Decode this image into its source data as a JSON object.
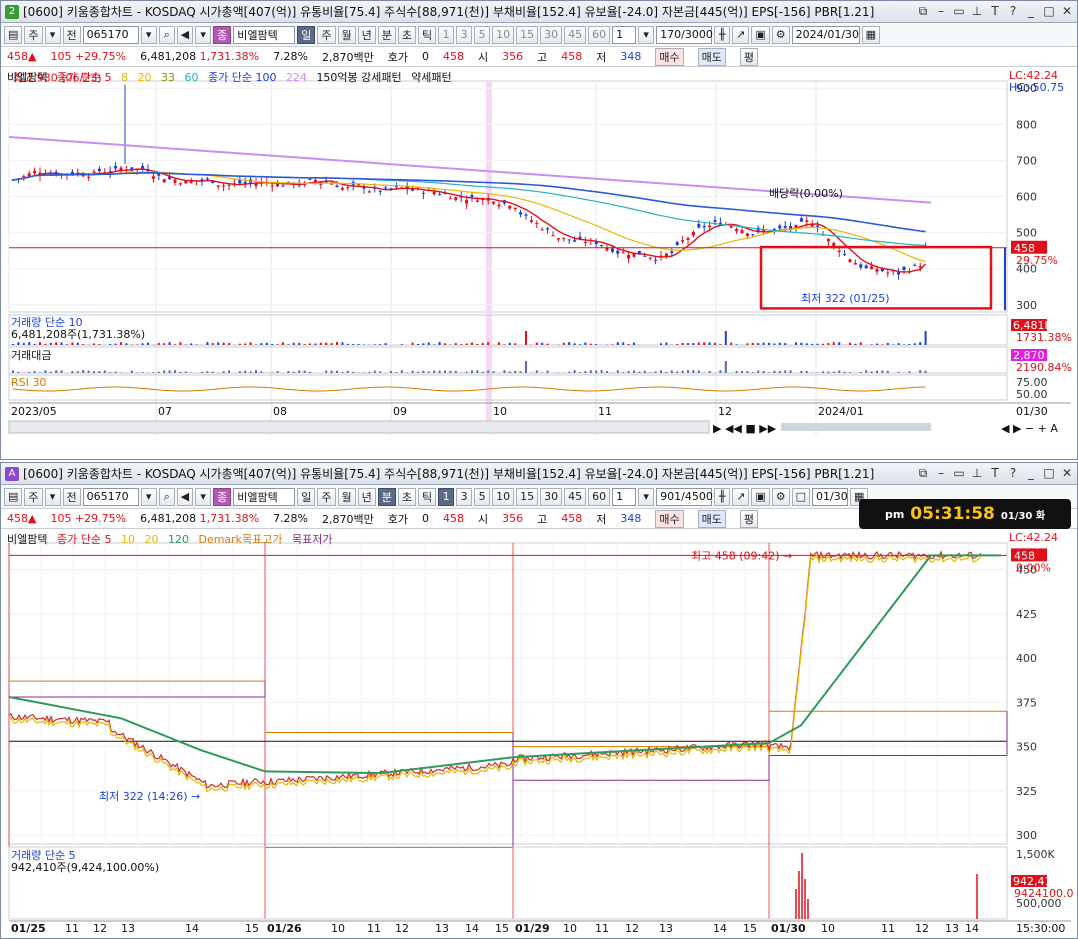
{
  "top": {
    "badge": "2",
    "title": "[0600] 키움종합차트 - KOSDAQ 시가총액[407(억)] 유통비율[75.4] 주식수[88,971(천)] 부채비율[152.4] 유보율[-24.0] 자본금[445(억)] EPS[-156] PBR[1.21]",
    "code": "065170",
    "type_label": "주",
    "prev_label": "전",
    "indicator_label": "비엘팜텍",
    "periods": [
      "일",
      "주",
      "월",
      "년",
      "분",
      "초",
      "틱"
    ],
    "selected_period": "일",
    "minutes": [
      "1",
      "3",
      "5",
      "10",
      "15",
      "30",
      "45",
      "60"
    ],
    "count_value": "1",
    "range_value": "170/3000",
    "date_value": "2024/01/30",
    "quote": {
      "price": "458",
      "change": "105",
      "rate": "+29.75%",
      "volume": "6,481,208",
      "vol_rate": "1,731.38%",
      "turnover": "7.28%",
      "amount": "2,870백만",
      "hoga_label": "호가",
      "hoga": "0",
      "cur": "458",
      "open_label": "시",
      "open": "356",
      "high_label": "고",
      "high": "458",
      "low_label": "저",
      "low": "348",
      "buy": "매수",
      "sell": "매도",
      "flat": "평"
    },
    "legend": [
      "비엘팜텍",
      "종가 단순 5",
      "8",
      "20",
      "33",
      "60",
      "종가 단순 100",
      "224",
      "150억봉 강세패턴",
      "약세패턴"
    ],
    "high_annot": "최고 930 (06/23)",
    "low_annot": "최저 322 (01/25)",
    "div_annot": "배당락(0.00%)",
    "lc": "LC:42.24",
    "hc": "HC:-50.75",
    "price_ticks": [
      "900",
      "800",
      "700",
      "600",
      "500",
      "400",
      "300"
    ],
    "last_price": "458",
    "last_rate": "29.75%",
    "vol_legend": [
      "거래량",
      "단순 10"
    ],
    "vol_value": "6,481,208주(1,731.38%)",
    "vol_right": "6,481K",
    "vol_right2": "1731.38%",
    "amt_legend": "거래대금",
    "amt_right": "2,870",
    "amt_right2": "2190.84%",
    "rsi_legend": "RSI 30",
    "rsi_ticks": [
      "75.00",
      "50.00"
    ],
    "x_labels": [
      "2023/05",
      "07",
      "08",
      "09",
      "10",
      "11",
      "12",
      "2024/01"
    ],
    "x_right": "01/30"
  },
  "bottom": {
    "badge": "A",
    "title": "[0600] 키움종합차트 - KOSDAQ 시가총액[407(억)] 유통비율[75.4] 주식수[88,971(천)] 부채비율[152.4] 유보율[-24.0] 자본금[445(억)] EPS[-156] PBR[1.21]",
    "code": "065170",
    "type_label": "주",
    "prev_label": "전",
    "indicator_label": "비엘팜텍",
    "periods": [
      "일",
      "주",
      "월",
      "년",
      "분",
      "초",
      "틱"
    ],
    "selected_period": "분",
    "minutes": [
      "1",
      "3",
      "5",
      "10",
      "15",
      "30",
      "45",
      "60"
    ],
    "selected_minute": "1",
    "count_value": "1",
    "range_value": "901/4500",
    "date_value": "01/30",
    "clock_prefix": "pm",
    "clock_time": "05:31:58",
    "clock_date": "01/30 화",
    "legend": [
      "비엘팜텍",
      "종가 단순 5",
      "10",
      "20",
      "120",
      "Demark목표고가",
      "목표저가"
    ],
    "high_annot": "최고 458 (09:42)",
    "low_annot": "최저 322 (14:26)",
    "lc": "LC:42.24",
    "price_ticks": [
      "450",
      "425",
      "400",
      "375",
      "350",
      "325",
      "300"
    ],
    "last_price": "458",
    "last_rate": "0.00%",
    "vol_legend": [
      "거래량",
      "단순 5"
    ],
    "vol_value": "942,410주(9,424,100.00%)",
    "vol_ticks": [
      "1,500K",
      "500,000"
    ],
    "vol_right": "942,410",
    "vol_right2": "9424100.0",
    "x_labels": [
      "01/25",
      "11",
      "12",
      "13",
      "14",
      "15",
      "01/26",
      "10",
      "11",
      "12",
      "13",
      "14",
      "15",
      "01/29",
      "10",
      "11",
      "12",
      "13",
      "14",
      "15",
      "01/30",
      "10",
      "11",
      "12",
      "13",
      "14"
    ],
    "x_right": "15:30:00"
  },
  "colors": {
    "up": "#e0101a",
    "down": "#1a3fd6",
    "ma5": "#e0101a",
    "ma20": "#e8b800",
    "ma224": "#c98ef0",
    "ma100": "#2a5ad8",
    "green": "#2e9a5a"
  }
}
